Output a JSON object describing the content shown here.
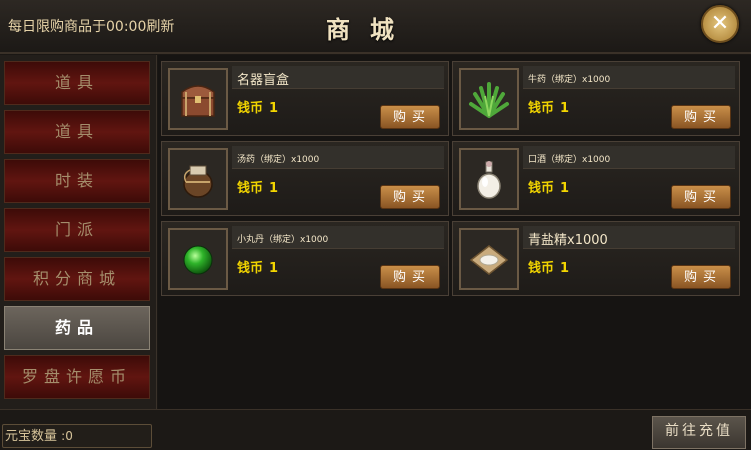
{
  "header": {
    "notice": "每日限购商品于00:00刷新",
    "title": "商城",
    "close_symbol": "✕"
  },
  "sidebar": {
    "tabs": [
      {
        "label": "道具"
      },
      {
        "label": "道具"
      },
      {
        "label": "时装"
      },
      {
        "label": "门派"
      },
      {
        "label": "积分商城"
      },
      {
        "label": "药品",
        "active": true
      },
      {
        "label": "罗盘许愿币"
      }
    ]
  },
  "items": [
    {
      "name": "名器盲盒",
      "currency": "钱币",
      "price": "1",
      "buy": "购买",
      "icon": "treasure-box-icon"
    },
    {
      "name": "牛药（绑定）x1000",
      "currency": "钱币",
      "price": "1",
      "buy": "购买",
      "icon": "herb-icon"
    },
    {
      "name": "汤药（绑定）x1000",
      "currency": "钱币",
      "price": "1",
      "buy": "购买",
      "icon": "jar-icon"
    },
    {
      "name": "口酒（绑定）x1000",
      "currency": "钱币",
      "price": "1",
      "buy": "购买",
      "icon": "wine-bottle-icon"
    },
    {
      "name": "小丸丹（绑定）x1000",
      "currency": "钱币",
      "price": "1",
      "buy": "购买",
      "icon": "green-pill-icon"
    },
    {
      "name": "青盐精x1000",
      "currency": "钱币",
      "price": "1",
      "buy": "购买",
      "icon": "salt-packet-icon"
    }
  ],
  "footer": {
    "yuanbao_label": "元宝数量",
    "yuanbao_value": ":0",
    "recharge": "前往充值"
  }
}
